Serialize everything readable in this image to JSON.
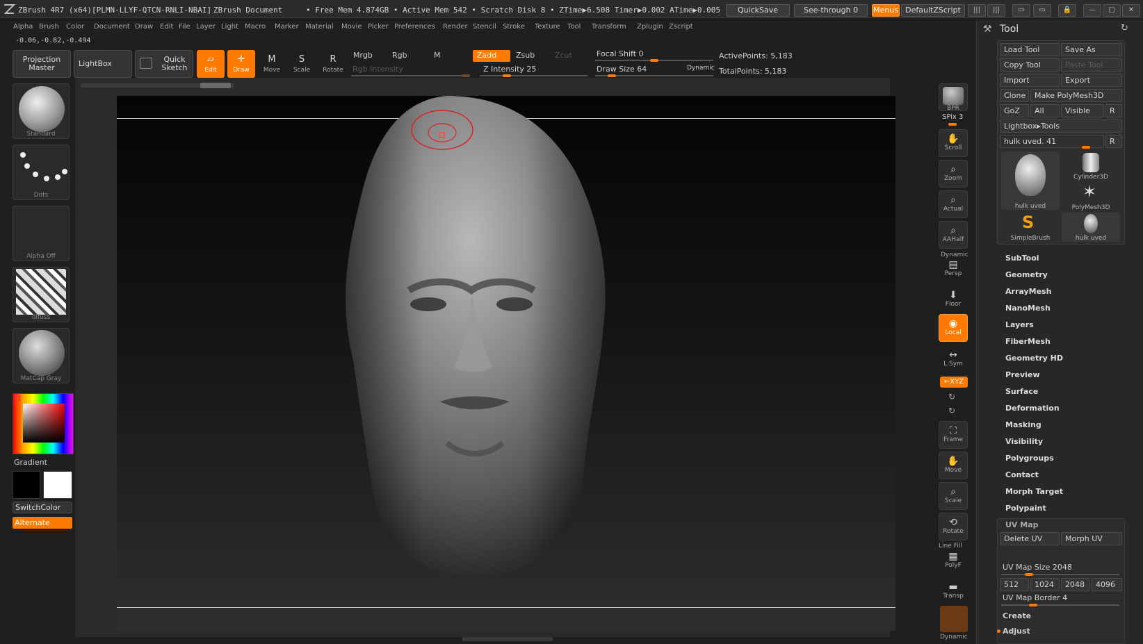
{
  "titlebar": {
    "app_title": "ZBrush 4R7 (x64)[PLMN-LLYF-QTCN-RNLI-NBAI]",
    "document": "ZBrush Document",
    "stats": "• Free Mem 4.874GB • Active Mem 542 • Scratch Disk 8 •  ZTime▶6.508 Timer▶0.002 ATime▶0.005",
    "quicksave": "QuickSave",
    "see_through": "See-through  0",
    "menus": "Menus",
    "script": "DefaultZScript"
  },
  "menubar": [
    "Alpha",
    "Brush",
    "Color",
    "Document",
    "Draw",
    "Edit",
    "File",
    "Layer",
    "Light",
    "Macro",
    "Marker",
    "Material",
    "Movie",
    "Picker",
    "Preferences",
    "Render",
    "Stencil",
    "Stroke",
    "Texture",
    "Tool",
    "Transform",
    "Zplugin",
    "Zscript"
  ],
  "coords": "-0.06,-0.82,-0.494",
  "shelf": {
    "projection_master": "Projection Master",
    "lightbox": "LightBox",
    "quick_sketch": "Quick Sketch",
    "edit": "Edit",
    "draw": "Draw",
    "move": "Move",
    "scale": "Scale",
    "rotate": "Rotate",
    "mrgb": "Mrgb",
    "rgb": "Rgb",
    "m": "M",
    "zadd": "Zadd",
    "zsub": "Zsub",
    "zcut": "Zcut",
    "rgb_intensity": "Rgb Intensity",
    "z_intensity": "Z Intensity 25",
    "focal_shift": "Focal Shift 0",
    "draw_size": "Draw Size 64",
    "dynamic": "Dynamic",
    "active_points": "ActivePoints: 5,183",
    "total_points": "TotalPoints: 5,183",
    "z_intensity_value": 25,
    "focal_shift_value": 0,
    "draw_size_value": 64
  },
  "left": {
    "brush": "Standard",
    "stroke": "Dots",
    "alpha": "Alpha Off",
    "texture": "difuss",
    "material": "MatCap Gray",
    "gradient": "Gradient",
    "switch_color": "SwitchColor",
    "alternate": "Alternate"
  },
  "right": {
    "bpr": "BPR",
    "spix": "SPix 3",
    "scroll": "Scroll",
    "zoom": "Zoom",
    "actual": "Actual",
    "aahalf": "AAHalf",
    "dynamic_persp": "Dynamic",
    "persp": "Persp",
    "floor": "Floor",
    "local": "Local",
    "lsym": "L.Sym",
    "xyz": "←XYZ",
    "frame": "Frame",
    "move": "Move",
    "scale": "Scale",
    "rotate": "Rotate",
    "line_fill": "Line Fill",
    "polyf": "PolyF",
    "transp": "Transp",
    "dynamic_bottom": "Dynamic"
  },
  "palette": {
    "title": "Tool",
    "load_tool": "Load Tool",
    "save_as": "Save As",
    "copy_tool": "Copy Tool",
    "paste_tool": "Paste Tool",
    "import": "Import",
    "export": "Export",
    "clone": "Clone",
    "make_polymesh": "Make PolyMesh3D",
    "goz": "GoZ",
    "all": "All",
    "visible": "Visible",
    "r": "R",
    "lightbox_tools": "Lightbox▸Tools",
    "current_tool": "hulk uved. 41",
    "tiles": [
      "hulk uved",
      "Cylinder3D",
      "PolyMesh3D",
      "SimpleBrush",
      "hulk uved"
    ],
    "sections": [
      "SubTool",
      "Geometry",
      "ArrayMesh",
      "NanoMesh",
      "Layers",
      "FiberMesh",
      "Geometry HD",
      "Preview",
      "Surface",
      "Deformation",
      "Masking",
      "Visibility",
      "Polygroups",
      "Contact",
      "Morph Target",
      "Polypaint"
    ],
    "uv_map": "UV Map",
    "delete_uv": "Delete UV",
    "morph_uv": "Morph UV",
    "uv_map_size": "UV Map Size 2048",
    "sizes": [
      "512",
      "1024",
      "2048",
      "4096"
    ],
    "uv_map_border": "UV Map Border 4",
    "create": "Create",
    "adjust": "Adjust"
  },
  "colors": {
    "accent": "#ff7a00",
    "background": "#1f1f1f"
  }
}
